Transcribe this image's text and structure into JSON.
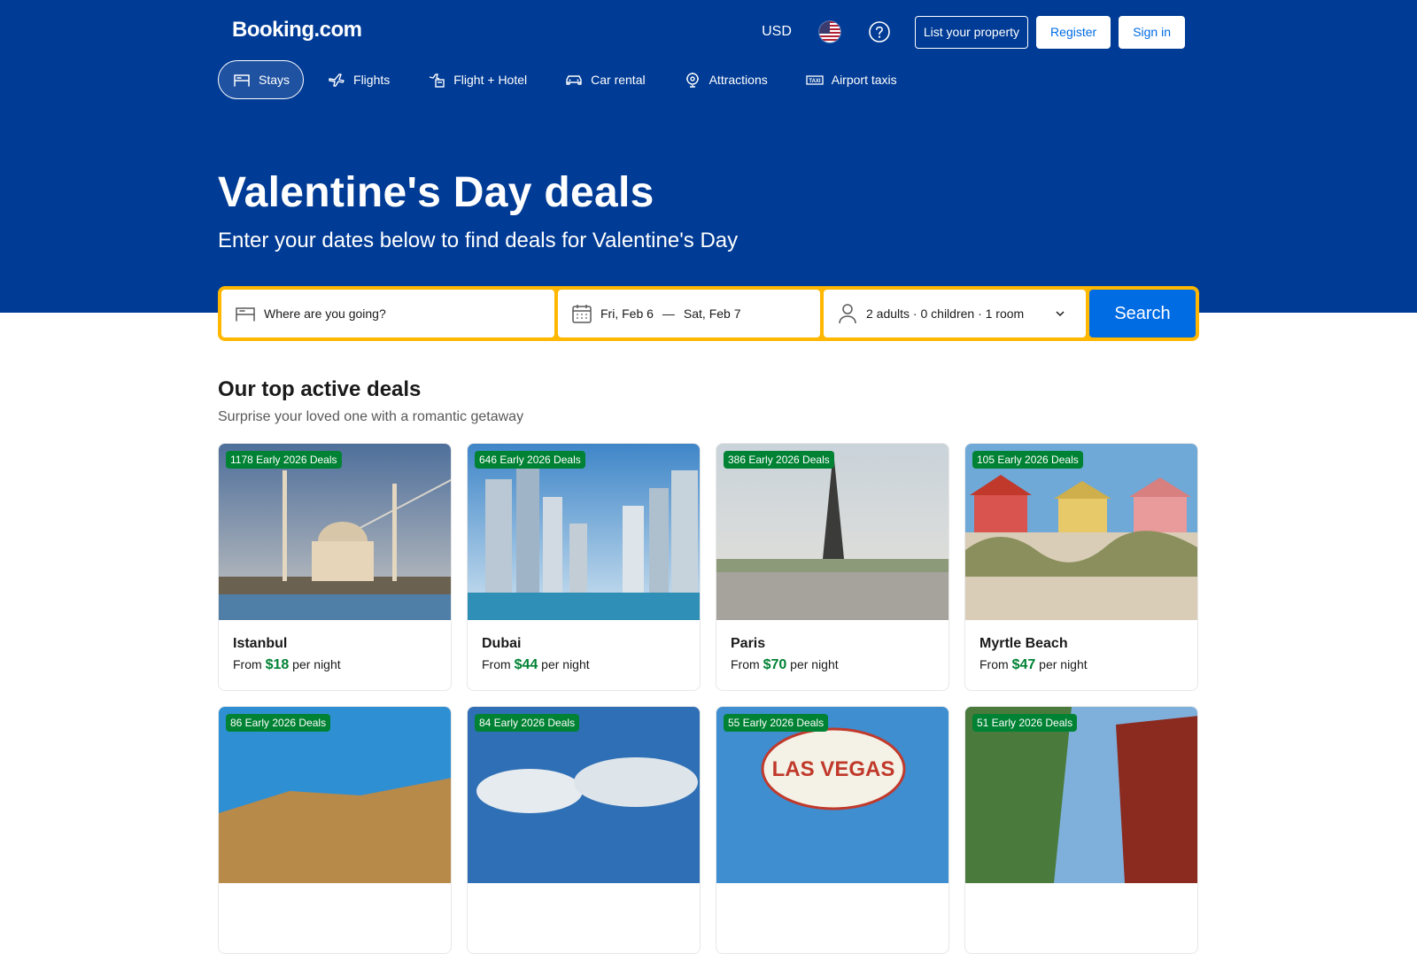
{
  "header": {
    "logo": "Booking.com",
    "currency": "USD",
    "list_property": "List your property",
    "register": "Register",
    "sign_in": "Sign in"
  },
  "nav": [
    {
      "label": "Stays",
      "icon": "bed-icon",
      "active": true
    },
    {
      "label": "Flights",
      "icon": "plane-icon"
    },
    {
      "label": "Flight + Hotel",
      "icon": "flight-hotel-icon"
    },
    {
      "label": "Car rental",
      "icon": "car-icon"
    },
    {
      "label": "Attractions",
      "icon": "attractions-icon"
    },
    {
      "label": "Airport taxis",
      "icon": "taxi-icon"
    }
  ],
  "hero": {
    "title": "Valentine's Day deals",
    "subtitle": "Enter your dates below to find deals for Valentine's Day"
  },
  "search": {
    "destination_placeholder": "Where are you going?",
    "checkin": "Fri, Feb 6",
    "separator": "—",
    "checkout": "Sat, Feb 7",
    "occupancy": "2 adults · 0 children · 1 room",
    "button": "Search"
  },
  "deals": {
    "title": "Our top active deals",
    "subtitle": "Surprise your loved one with a romantic getaway",
    "from_label": "From",
    "per_night_label": "per night",
    "cards": [
      {
        "badge": "1178 Early 2026 Deals",
        "city": "Istanbul",
        "price": "$18"
      },
      {
        "badge": "646 Early 2026 Deals",
        "city": "Dubai",
        "price": "$44"
      },
      {
        "badge": "386 Early 2026 Deals",
        "city": "Paris",
        "price": "$70"
      },
      {
        "badge": "105 Early 2026 Deals",
        "city": "Myrtle Beach",
        "price": "$47"
      },
      {
        "badge": "86 Early 2026 Deals"
      },
      {
        "badge": "84 Early 2026 Deals"
      },
      {
        "badge": "55 Early 2026 Deals",
        "sign_text": "LAS VEGAS"
      },
      {
        "badge": "51 Early 2026 Deals"
      }
    ]
  },
  "colors": {
    "brand_blue": "#003b95",
    "action_blue": "#006ce4",
    "search_border": "#ffb700",
    "deal_green": "#008234"
  }
}
